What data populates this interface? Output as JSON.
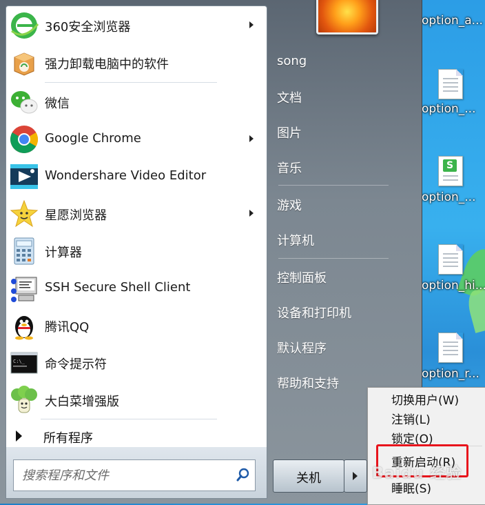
{
  "programs": [
    {
      "label": "360安全浏览器",
      "has_arrow": true,
      "icon": "360-browser-icon"
    },
    {
      "label": "强力卸载电脑中的软件",
      "has_arrow": false,
      "icon": "uninstall-box-icon"
    },
    {
      "label": "微信",
      "has_arrow": false,
      "icon": "wechat-icon"
    },
    {
      "label": "Google Chrome",
      "has_arrow": true,
      "icon": "chrome-icon"
    },
    {
      "label": "Wondershare Video Editor",
      "has_arrow": false,
      "icon": "video-editor-icon"
    },
    {
      "label": "星愿浏览器",
      "has_arrow": true,
      "icon": "star-browser-icon"
    },
    {
      "label": "计算器",
      "has_arrow": false,
      "icon": "calculator-icon"
    },
    {
      "label": "SSH Secure Shell Client",
      "has_arrow": false,
      "icon": "ssh-client-icon"
    },
    {
      "label": "腾讯QQ",
      "has_arrow": false,
      "icon": "qq-penguin-icon"
    },
    {
      "label": "命令提示符",
      "has_arrow": false,
      "icon": "cmd-icon"
    },
    {
      "label": "大白菜增强版",
      "has_arrow": false,
      "icon": "cabbage-icon"
    }
  ],
  "all_programs_label": "所有程序",
  "search": {
    "placeholder": "搜索程序和文件"
  },
  "right_pane": {
    "items": [
      "song",
      "文档",
      "图片",
      "音乐",
      "游戏",
      "计算机",
      "控制面板",
      "设备和打印机",
      "默认程序",
      "帮助和支持"
    ]
  },
  "shutdown": {
    "label": "关机"
  },
  "shutdown_menu": {
    "items": [
      "切换用户(W)",
      "注销(L)",
      "锁定(O)",
      "重新启动(R)",
      "睡眠(S)"
    ],
    "highlighted_index": 3,
    "highlight_color": "#e8141c"
  },
  "desktop_files": [
    {
      "label": "option_a...",
      "icon": "file-icon"
    },
    {
      "label": "option_...",
      "icon": "file-icon"
    },
    {
      "label": "option_...",
      "icon": "spreadsheet-icon"
    },
    {
      "label": "option_hi...",
      "icon": "file-icon"
    },
    {
      "label": "option_r...",
      "icon": "file-icon"
    }
  ],
  "watermark": "Baidu 经验",
  "colors": {
    "menu_bg": "#7c8791",
    "desktop": "#2f9be0",
    "chrome_red": "#db4437",
    "chrome_green": "#0f9d58",
    "chrome_yellow": "#f4b400",
    "chrome_blue": "#4285f4"
  }
}
